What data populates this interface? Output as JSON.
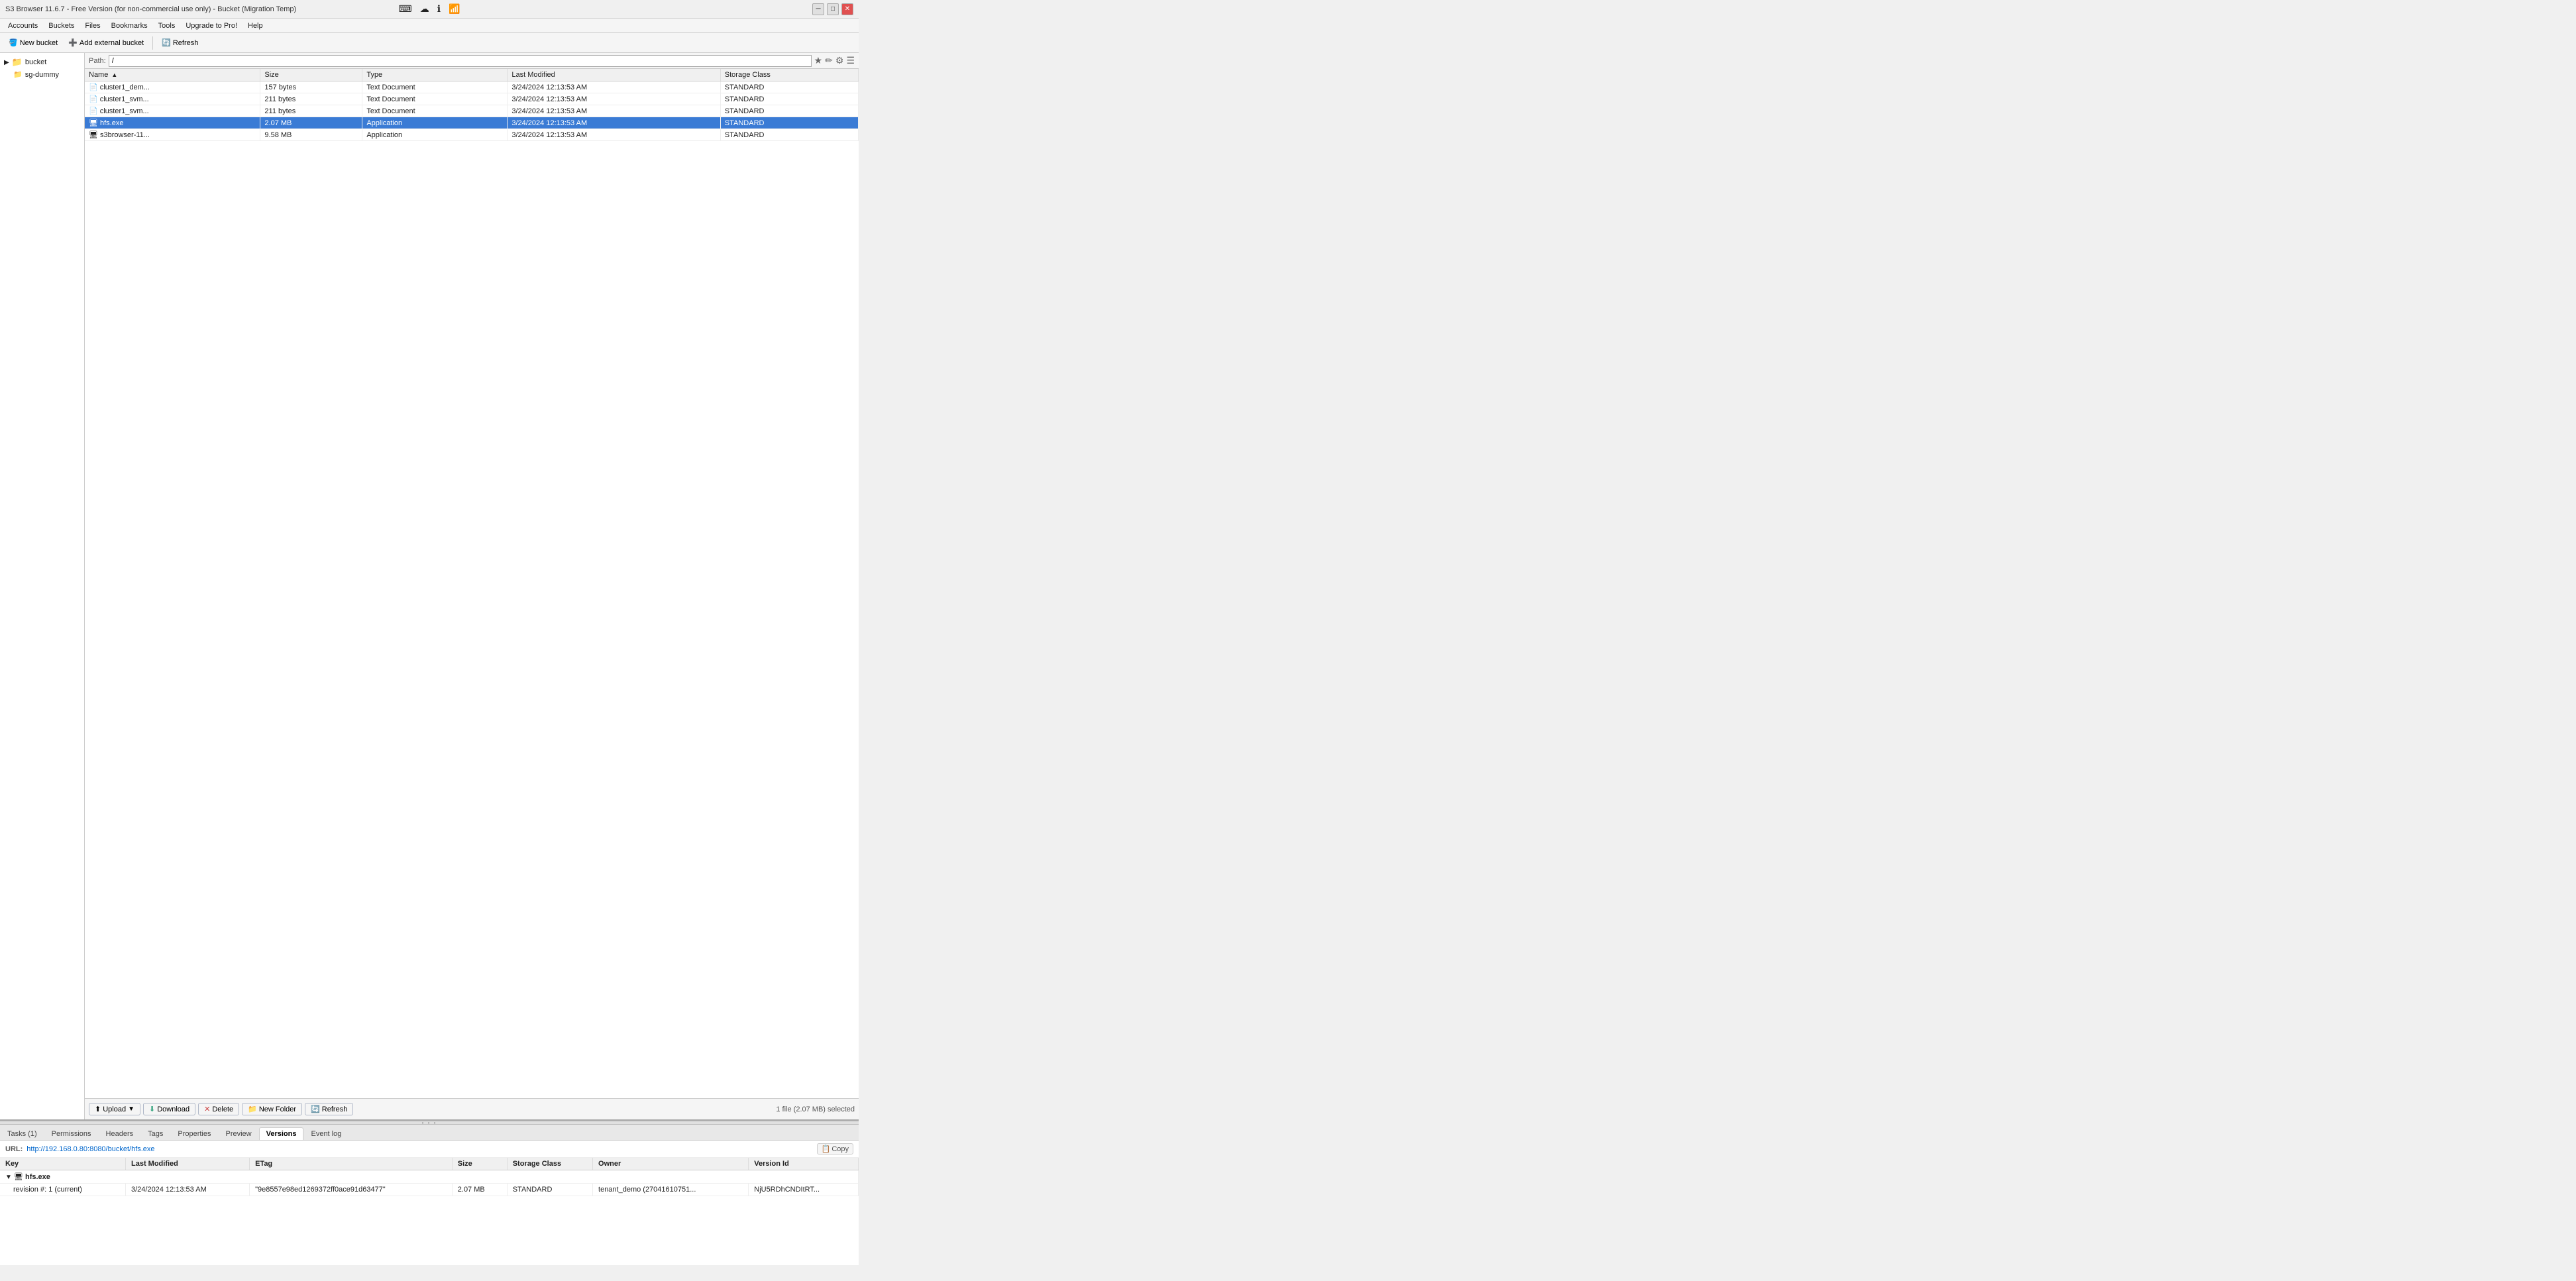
{
  "window": {
    "title": "S3 Browser 11.6.7 - Free Version (for non-commercial use only) - Bucket (Migration Temp)"
  },
  "title_bar": {
    "minimize": "─",
    "maximize": "□",
    "close": "✕"
  },
  "top_icons": [
    {
      "name": "keyboard-icon",
      "symbol": "⌨"
    },
    {
      "name": "cloud-icon",
      "symbol": "☁"
    },
    {
      "name": "info-icon",
      "symbol": "ℹ"
    },
    {
      "name": "signal-icon",
      "symbol": "📶"
    }
  ],
  "menu": {
    "items": [
      "Accounts",
      "Buckets",
      "Files",
      "Bookmarks",
      "Tools",
      "Upgrade to Pro!",
      "Help"
    ]
  },
  "action_toolbar": {
    "new_bucket": "New bucket",
    "add_external": "Add external bucket",
    "refresh": "Refresh"
  },
  "left_panel": {
    "items": [
      {
        "label": "bucket",
        "type": "folder",
        "level": 0
      },
      {
        "label": "sg-dummy",
        "type": "folder",
        "level": 1
      }
    ]
  },
  "path_bar": {
    "label": "Path:",
    "value": "/"
  },
  "file_list": {
    "columns": [
      {
        "label": "Name",
        "sortable": true,
        "sort_dir": "asc"
      },
      {
        "label": "Size",
        "sortable": true
      },
      {
        "label": "Type",
        "sortable": true
      },
      {
        "label": "Last Modified",
        "sortable": true
      },
      {
        "label": "Storage Class",
        "sortable": true
      }
    ],
    "rows": [
      {
        "name": "cluster1_dem...",
        "size": "157 bytes",
        "type": "Text Document",
        "modified": "3/24/2024 12:13:53 AM",
        "storage": "STANDARD",
        "selected": false,
        "icon": "📄"
      },
      {
        "name": "cluster1_svm...",
        "size": "211 bytes",
        "type": "Text Document",
        "modified": "3/24/2024 12:13:53 AM",
        "storage": "STANDARD",
        "selected": false,
        "icon": "📄"
      },
      {
        "name": "cluster1_svm...",
        "size": "211 bytes",
        "type": "Text Document",
        "modified": "3/24/2024 12:13:53 AM",
        "storage": "STANDARD",
        "selected": false,
        "icon": "📄"
      },
      {
        "name": "hfs.exe",
        "size": "2.07 MB",
        "type": "Application",
        "modified": "3/24/2024 12:13:53 AM",
        "storage": "STANDARD",
        "selected": true,
        "icon": "🖥"
      },
      {
        "name": "s3browser-11...",
        "size": "9.58 MB",
        "type": "Application",
        "modified": "3/24/2024 12:13:53 AM",
        "storage": "STANDARD",
        "selected": false,
        "icon": "🖥"
      }
    ]
  },
  "bottom_toolbar": {
    "upload": "Upload",
    "download": "Download",
    "delete": "Delete",
    "new_folder": "New Folder",
    "refresh": "Refresh",
    "status": "1 file (2.07 MB) selected"
  },
  "tabs": [
    {
      "label": "Tasks (1)",
      "active": false
    },
    {
      "label": "Permissions",
      "active": false
    },
    {
      "label": "Headers",
      "active": false
    },
    {
      "label": "Tags",
      "active": false
    },
    {
      "label": "Properties",
      "active": false
    },
    {
      "label": "Preview",
      "active": false
    },
    {
      "label": "Versions",
      "active": true
    },
    {
      "label": "Event log",
      "active": false
    }
  ],
  "url_bar": {
    "label": "URL:",
    "value": "http://192.168.0.80:8080/bucket/hfs.exe",
    "copy_label": "Copy"
  },
  "versions_table": {
    "columns": [
      "Key",
      "Last Modified",
      "ETag",
      "Size",
      "Storage Class",
      "Owner",
      "Version Id"
    ],
    "groups": [
      {
        "name": "hfs.exe",
        "icon": "🖥",
        "expanded": true,
        "rows": [
          {
            "key": "revision #: 1 (current)",
            "modified": "3/24/2024 12:13:53 AM",
            "etag": "\"9e8557e98ed1269372ff0ace91d63477\"",
            "size": "2.07 MB",
            "storage_class": "STANDARD",
            "owner": "tenant_demo (27041610751...",
            "version_id": "NjU5RDhCNDItRT..."
          }
        ]
      }
    ]
  }
}
